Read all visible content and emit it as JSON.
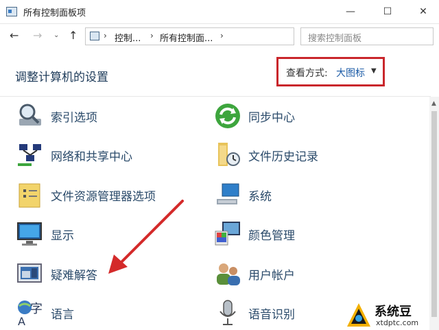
{
  "window": {
    "title": "所有控制面板项",
    "controls": {
      "minimize": "—",
      "maximize": "☐",
      "close": "✕"
    }
  },
  "nav": {
    "back": "←",
    "forward": "→",
    "recent": "⌄",
    "up": "↑",
    "breadcrumbs": [
      "控制...",
      "所有控制面..."
    ],
    "refresh": "↻",
    "search_placeholder": "搜索控制面板"
  },
  "header": {
    "title": "调整计算机的设置",
    "view_by_label": "查看方式:",
    "view_by_value": "大图标"
  },
  "items": [
    {
      "label": "索引选项",
      "icon": "magnifier-icon"
    },
    {
      "label": "同步中心",
      "icon": "sync-icon"
    },
    {
      "label": "网络和共享中心",
      "icon": "network-icon"
    },
    {
      "label": "文件历史记录",
      "icon": "file-history-icon"
    },
    {
      "label": "文件资源管理器选项",
      "icon": "folder-options-icon"
    },
    {
      "label": "系统",
      "icon": "system-icon"
    },
    {
      "label": "显示",
      "icon": "monitor-icon"
    },
    {
      "label": "颜色管理",
      "icon": "color-management-icon"
    },
    {
      "label": "疑难解答",
      "icon": "troubleshoot-icon"
    },
    {
      "label": "用户帐户",
      "icon": "users-icon"
    },
    {
      "label": "语言",
      "icon": "language-icon"
    },
    {
      "label": "语音识别",
      "icon": "microphone-icon"
    }
  ],
  "watermark": {
    "title": "系统豆",
    "subtitle": "xtdptc.com"
  },
  "colors": {
    "highlight_border": "#c9262b",
    "arrow": "#d42a2a",
    "link": "#1a5aa6"
  }
}
